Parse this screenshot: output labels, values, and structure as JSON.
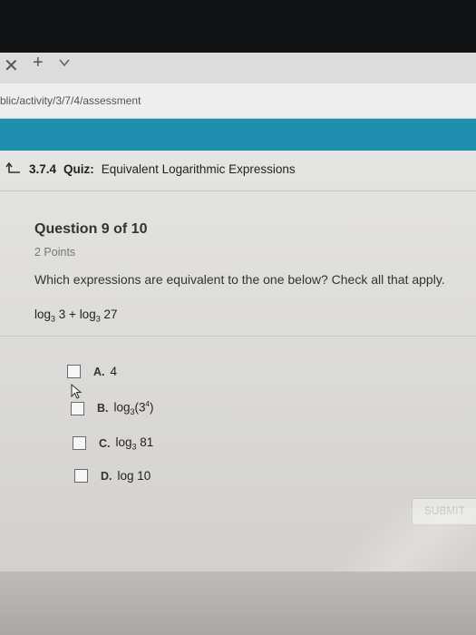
{
  "browser": {
    "url": "blic/activity/3/7/4/assessment"
  },
  "quiz": {
    "number": "3.7.4",
    "kind": "Quiz:",
    "title": "Equivalent Logarithmic Expressions"
  },
  "question": {
    "title": "Question 9 of 10",
    "points": "2 Points",
    "prompt": "Which expressions are equivalent to the one below? Check all that apply.",
    "expression": {
      "log1": "log",
      "base1": "3",
      "arg1": " 3 + ",
      "log2": "log",
      "base2": "3",
      "arg2": " 27"
    }
  },
  "options": [
    {
      "letter": "A.",
      "text": "4"
    },
    {
      "letter": "B.",
      "log": "log",
      "base": "3",
      "arg_open": "(3",
      "exp": "4",
      "arg_close": ")"
    },
    {
      "letter": "C.",
      "log": "log",
      "base": "3",
      "arg": " 81"
    },
    {
      "letter": "D.",
      "text": "log 10"
    }
  ],
  "submit_label": "SUBMIT",
  "colors": {
    "banner": "#1f8fb0",
    "bezel": "#111214"
  }
}
